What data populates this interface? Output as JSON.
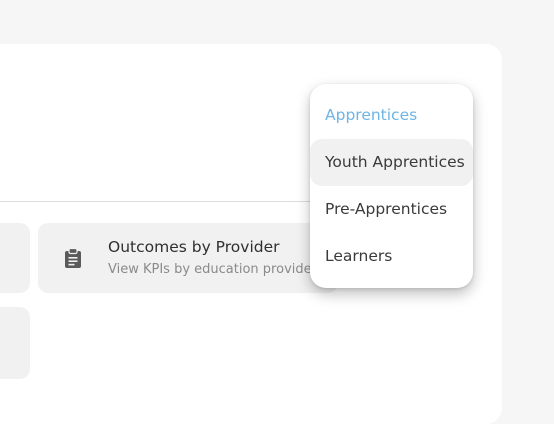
{
  "card": {
    "title": "Outcomes by Provider",
    "subtitle": "View KPIs by education provider",
    "icon": "clipboard-icon"
  },
  "menu": {
    "items": [
      {
        "label": "Apprentices",
        "state": "selected"
      },
      {
        "label": "Youth Apprentices",
        "state": "hover"
      },
      {
        "label": "Pre-Apprentices",
        "state": "normal"
      },
      {
        "label": "Learners",
        "state": "normal"
      }
    ]
  },
  "colors": {
    "accent": "#6eb4e6",
    "card_bg": "#f1f1f1",
    "icon": "#5a5a5a"
  }
}
